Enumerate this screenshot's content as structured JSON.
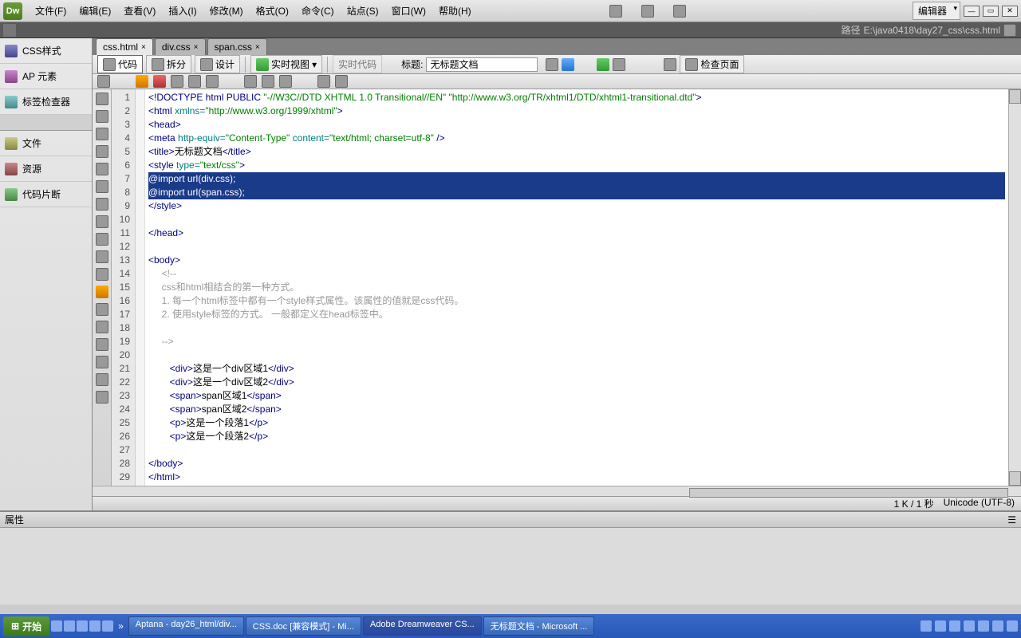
{
  "menubar": {
    "items": [
      "文件(F)",
      "编辑(E)",
      "查看(V)",
      "插入(I)",
      "修改(M)",
      "格式(O)",
      "命令(C)",
      "站点(S)",
      "窗口(W)",
      "帮助(H)"
    ],
    "layout_label": "编辑器"
  },
  "pathbar": {
    "prefix": "路径",
    "path": "E:\\java0418\\day27_css\\css.html"
  },
  "left_panel": {
    "items": [
      {
        "label": "CSS样式",
        "icon": "i-css"
      },
      {
        "label": "AP 元素",
        "icon": "i-els"
      },
      {
        "label": "标签检查器",
        "icon": "i-tag"
      },
      {
        "label": "文件",
        "icon": "i-file"
      },
      {
        "label": "资源",
        "icon": "i-res"
      },
      {
        "label": "代码片断",
        "icon": "i-snip"
      }
    ]
  },
  "tabs": [
    {
      "label": "css.html",
      "active": true
    },
    {
      "label": "div.css",
      "active": false
    },
    {
      "label": "span.css",
      "active": false
    }
  ],
  "doc_toolbar": {
    "code": "代码",
    "split": "拆分",
    "design": "设计",
    "live": "实时视图",
    "live_code": "实时代码",
    "title_label": "标题:",
    "title_value": "无标题文档",
    "check": "检查页面"
  },
  "statusbar": {
    "size": "1 K / 1 秒",
    "encoding": "Unicode (UTF-8)"
  },
  "prop_panel": {
    "title": "属性"
  },
  "code_lines": [
    {
      "n": 1,
      "html": "<span class='tag'>&lt;!DOCTYPE html PUBLIC</span> <span class='str'>\"-//W3C//DTD XHTML 1.0 Transitional//EN\" \"http://www.w3.org/TR/xhtml1/DTD/xhtml1-transitional.dtd\"</span><span class='tag'>&gt;</span>"
    },
    {
      "n": 2,
      "html": "<span class='tag'>&lt;html</span> <span class='attr'>xmlns=</span><span class='str'>\"http://www.w3.org/1999/xhtml\"</span><span class='tag'>&gt;</span>"
    },
    {
      "n": 3,
      "html": "<span class='tag'>&lt;head&gt;</span>"
    },
    {
      "n": 4,
      "html": "<span class='tag'>&lt;meta</span> <span class='attr'>http-equiv=</span><span class='str'>\"Content-Type\"</span> <span class='attr'>content=</span><span class='str'>\"text/html; charset=utf-8\"</span> <span class='tag'>/&gt;</span>"
    },
    {
      "n": 5,
      "html": "<span class='tag'>&lt;title&gt;</span>无标题文档<span class='tag'>&lt;/title&gt;</span>"
    },
    {
      "n": 6,
      "html": "<span class='tag'>&lt;style</span> <span class='attr'>type=</span><span class='str'>\"text/css\"</span><span class='tag'>&gt;</span>"
    },
    {
      "n": 7,
      "html": "<span class='sel'>@import url(div.css);</span>",
      "selected": true
    },
    {
      "n": 8,
      "html": "<span class='sel'>@import url(span.css);</span>",
      "selected": true
    },
    {
      "n": 9,
      "html": "<span class='tag'>&lt;/style&gt;</span>"
    },
    {
      "n": 10,
      "html": ""
    },
    {
      "n": 11,
      "html": "<span class='tag'>&lt;/head&gt;</span>"
    },
    {
      "n": 12,
      "html": ""
    },
    {
      "n": 13,
      "html": "<span class='tag'>&lt;body&gt;</span>"
    },
    {
      "n": 14,
      "html": "     <span class='com'>&lt;!--</span>"
    },
    {
      "n": 15,
      "html": "     <span class='com'>css和html相结合的第一种方式。</span>"
    },
    {
      "n": 16,
      "html": "     <span class='com'>1. 每一个html标签中都有一个style样式属性。该属性的值就是css代码。</span>"
    },
    {
      "n": 17,
      "html": "     <span class='com'>2. 使用style标签的方式。 一般都定义在head标签中。</span>"
    },
    {
      "n": 18,
      "html": ""
    },
    {
      "n": 19,
      "html": "     <span class='com'>--&gt;</span>"
    },
    {
      "n": 20,
      "html": ""
    },
    {
      "n": 21,
      "html": "        <span class='tag'>&lt;div&gt;</span>这是一个div区域1<span class='tag'>&lt;/div&gt;</span>"
    },
    {
      "n": 22,
      "html": "        <span class='tag'>&lt;div&gt;</span>这是一个div区域2<span class='tag'>&lt;/div&gt;</span>"
    },
    {
      "n": 23,
      "html": "        <span class='tag'>&lt;span&gt;</span>span区域1<span class='tag'>&lt;/span&gt;</span>"
    },
    {
      "n": 24,
      "html": "        <span class='tag'>&lt;span&gt;</span>span区域2<span class='tag'>&lt;/span&gt;</span>"
    },
    {
      "n": 25,
      "html": "        <span class='tag'>&lt;p&gt;</span>这是一个段落1<span class='tag'>&lt;/p&gt;</span>"
    },
    {
      "n": 26,
      "html": "        <span class='tag'>&lt;p&gt;</span>这是一个段落2<span class='tag'>&lt;/p&gt;</span>"
    },
    {
      "n": 27,
      "html": ""
    },
    {
      "n": 28,
      "html": "<span class='tag'>&lt;/body&gt;</span>"
    },
    {
      "n": 29,
      "html": "<span class='tag'>&lt;/html&gt;</span>"
    }
  ],
  "taskbar": {
    "start": "开始",
    "items": [
      "Aptana - day26_html/div...",
      "CSS.doc [兼容模式] - Mi...",
      "Adobe Dreamweaver CS...",
      "无标题文档 - Microsoft ..."
    ]
  }
}
